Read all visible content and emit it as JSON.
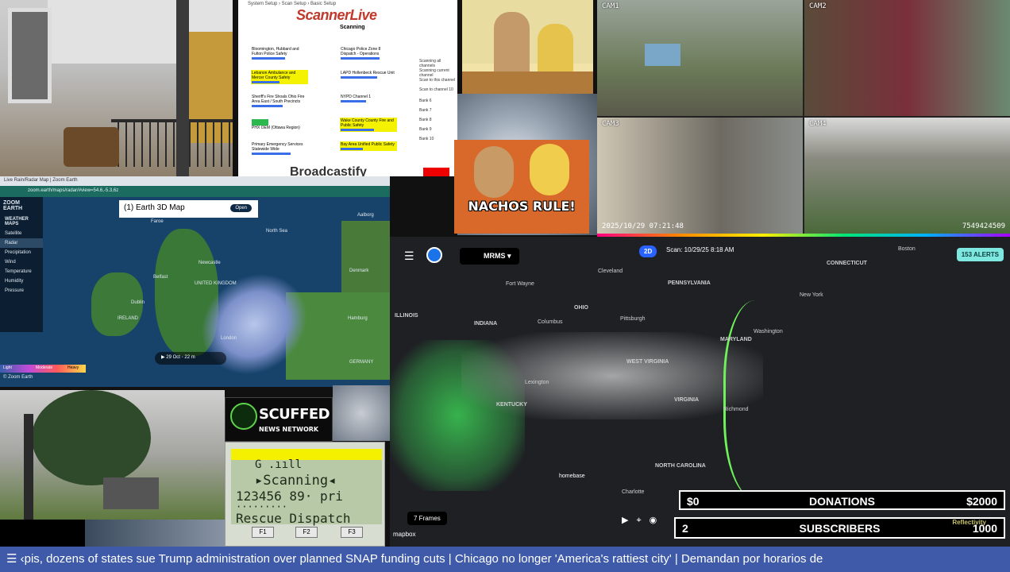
{
  "scanner": {
    "breadcrumb": "System Setup › Scan Setup › Basic Setup",
    "brand": "ScannerLive",
    "status": "Scanning",
    "channels": [
      "Bloomington, Hubbard and Fulton Police Safety",
      "Chicago Police Zone 8 Dispatch - Operations",
      "Lebanon Ambulance and Mercer County Safety",
      "LAPD Hollenbeck Rescue Unit",
      "Sheriff's Fire Shoals Ohio Fire Area East / South Precincts",
      "NYPD Channel 1",
      "PHX OEM (Ottawa Region)",
      "Wake County County Fire and Public Safety",
      "Primary Emergency Services Statewide Wide",
      "Bay Area Unified Public Safety"
    ],
    "options": [
      "Scanning all channels",
      "Scanning current channel",
      "Scan to this channel",
      "Scan to channel 10",
      "Bank 6",
      "Bank 7",
      "Bank 8",
      "Bank 9",
      "Bank 10"
    ],
    "broadcastify": "Broadcastify"
  },
  "beavis": {
    "caption": "NACHOS RULE!"
  },
  "cameras": {
    "labels": [
      "CAM1",
      "CAM2",
      "CAM3",
      "CAM4"
    ],
    "timestamp": "2025/10/29 07:21:48",
    "id": "7549424509"
  },
  "zoom": {
    "tab": "Live Rain/Radar Map | Zoom Earth",
    "url": "zoom.earth/maps/radar/#view=54.6,-5.3,6z",
    "logo": "ZOOM EARTH",
    "layers_title": "WEATHER MAPS",
    "layers": [
      "Satellite",
      "Radar",
      "Precipitation",
      "Wind",
      "Temperature",
      "Humidity",
      "Pressure"
    ],
    "banner": "(1) Earth 3D Map",
    "banner_btn": "Open",
    "playbar": "▶  29 Oct   ◦   22 m",
    "places": [
      "Faroe",
      "North Sea",
      "IRELAND",
      "UNITED KINGDOM",
      "Belfast",
      "Dublin",
      "Newcastle",
      "London",
      "Denmark",
      "GERMANY",
      "Aalborg",
      "Hamburg"
    ],
    "legend_labels": [
      "Light",
      "Moderate",
      "Heavy"
    ],
    "footer": "© Zoom Earth"
  },
  "scuffed": {
    "title": "SCUFFED",
    "subtitle": "NEWS NETWORK"
  },
  "scanner_display": {
    "top": "G    .ııll",
    "line1": "▸Scanning◂",
    "line2": "123456 89·  pri",
    "line3": "·········",
    "line4": "Rescue Dispatch",
    "fkeys": [
      "F1",
      "F2",
      "F3"
    ]
  },
  "radar": {
    "menu_icon": "hamburger-icon",
    "product": "MRMS",
    "mode": "2D",
    "scan": "Scan: 10/29/25 8:18 AM",
    "alerts": "153 ALERTS",
    "states": [
      "PENNSYLVANIA",
      "OHIO",
      "INDIANA",
      "ILLINOIS",
      "WEST VIRGINIA",
      "VIRGINIA",
      "KENTUCKY",
      "NORTH CAROLINA",
      "MARYLAND",
      "CONNECTICUT"
    ],
    "cities": [
      "Pittsburgh",
      "Columbus",
      "Fort Wayne",
      "Cleveland",
      "Washington",
      "New York",
      "Boston",
      "Lexington",
      "Richmond",
      "Charlotte"
    ],
    "frames": "7 Frames",
    "mapbox": "mapbox",
    "homebase": "homebase"
  },
  "stats": {
    "donations_left": "$0",
    "donations_label": "DONATIONS",
    "donations_right": "$2000",
    "subscribers_left": "2",
    "subscribers_label": "SUBSCRIBERS",
    "subscribers_right": "1000",
    "reflectivity": "Reflectivity"
  },
  "ticker": {
    "text": "☰  ‹pis, dozens of states sue Trump administration over planned SNAP funding cuts   |   Chicago no longer 'America's rattiest city'   |   Demandan por horarios de"
  }
}
